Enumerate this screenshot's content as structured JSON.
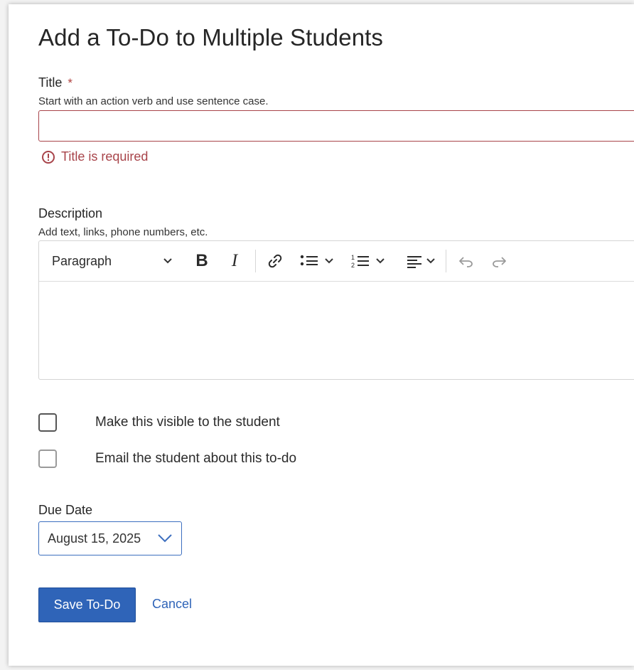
{
  "form": {
    "title": "Add a To-Do to Multiple Students",
    "title_field": {
      "label": "Title",
      "required_marker": "*",
      "hint": "Start with an action verb and use sentence case.",
      "value": "",
      "error": "Title is required"
    },
    "description_field": {
      "label": "Description",
      "hint": "Add text, links, phone numbers, etc.",
      "value": ""
    },
    "toolbar": {
      "block_format": "Paragraph",
      "bold": "B",
      "italic": "I"
    },
    "checkboxes": [
      {
        "label": "Make this visible to the student",
        "checked": false
      },
      {
        "label": "Email the student about this to-do",
        "checked": false
      }
    ],
    "due_date": {
      "label": "Due Date",
      "value": "August 15, 2025"
    },
    "actions": {
      "save_label": "Save To-Do",
      "cancel_label": "Cancel"
    }
  },
  "colors": {
    "error": "#a8444a",
    "primary": "#2f64b8",
    "focus_border": "#3d6fbf"
  }
}
